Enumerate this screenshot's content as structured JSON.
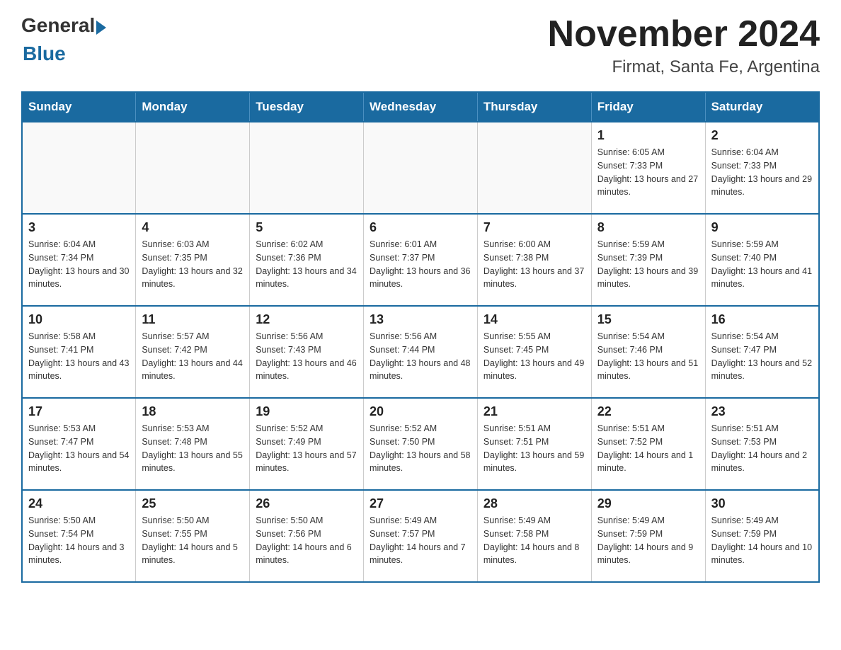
{
  "header": {
    "logo_general": "General",
    "logo_blue": "Blue",
    "title": "November 2024",
    "subtitle": "Firmat, Santa Fe, Argentina"
  },
  "days_of_week": [
    "Sunday",
    "Monday",
    "Tuesday",
    "Wednesday",
    "Thursday",
    "Friday",
    "Saturday"
  ],
  "weeks": [
    [
      {
        "day": "",
        "info": ""
      },
      {
        "day": "",
        "info": ""
      },
      {
        "day": "",
        "info": ""
      },
      {
        "day": "",
        "info": ""
      },
      {
        "day": "",
        "info": ""
      },
      {
        "day": "1",
        "info": "Sunrise: 6:05 AM\nSunset: 7:33 PM\nDaylight: 13 hours and 27 minutes."
      },
      {
        "day": "2",
        "info": "Sunrise: 6:04 AM\nSunset: 7:33 PM\nDaylight: 13 hours and 29 minutes."
      }
    ],
    [
      {
        "day": "3",
        "info": "Sunrise: 6:04 AM\nSunset: 7:34 PM\nDaylight: 13 hours and 30 minutes."
      },
      {
        "day": "4",
        "info": "Sunrise: 6:03 AM\nSunset: 7:35 PM\nDaylight: 13 hours and 32 minutes."
      },
      {
        "day": "5",
        "info": "Sunrise: 6:02 AM\nSunset: 7:36 PM\nDaylight: 13 hours and 34 minutes."
      },
      {
        "day": "6",
        "info": "Sunrise: 6:01 AM\nSunset: 7:37 PM\nDaylight: 13 hours and 36 minutes."
      },
      {
        "day": "7",
        "info": "Sunrise: 6:00 AM\nSunset: 7:38 PM\nDaylight: 13 hours and 37 minutes."
      },
      {
        "day": "8",
        "info": "Sunrise: 5:59 AM\nSunset: 7:39 PM\nDaylight: 13 hours and 39 minutes."
      },
      {
        "day": "9",
        "info": "Sunrise: 5:59 AM\nSunset: 7:40 PM\nDaylight: 13 hours and 41 minutes."
      }
    ],
    [
      {
        "day": "10",
        "info": "Sunrise: 5:58 AM\nSunset: 7:41 PM\nDaylight: 13 hours and 43 minutes."
      },
      {
        "day": "11",
        "info": "Sunrise: 5:57 AM\nSunset: 7:42 PM\nDaylight: 13 hours and 44 minutes."
      },
      {
        "day": "12",
        "info": "Sunrise: 5:56 AM\nSunset: 7:43 PM\nDaylight: 13 hours and 46 minutes."
      },
      {
        "day": "13",
        "info": "Sunrise: 5:56 AM\nSunset: 7:44 PM\nDaylight: 13 hours and 48 minutes."
      },
      {
        "day": "14",
        "info": "Sunrise: 5:55 AM\nSunset: 7:45 PM\nDaylight: 13 hours and 49 minutes."
      },
      {
        "day": "15",
        "info": "Sunrise: 5:54 AM\nSunset: 7:46 PM\nDaylight: 13 hours and 51 minutes."
      },
      {
        "day": "16",
        "info": "Sunrise: 5:54 AM\nSunset: 7:47 PM\nDaylight: 13 hours and 52 minutes."
      }
    ],
    [
      {
        "day": "17",
        "info": "Sunrise: 5:53 AM\nSunset: 7:47 PM\nDaylight: 13 hours and 54 minutes."
      },
      {
        "day": "18",
        "info": "Sunrise: 5:53 AM\nSunset: 7:48 PM\nDaylight: 13 hours and 55 minutes."
      },
      {
        "day": "19",
        "info": "Sunrise: 5:52 AM\nSunset: 7:49 PM\nDaylight: 13 hours and 57 minutes."
      },
      {
        "day": "20",
        "info": "Sunrise: 5:52 AM\nSunset: 7:50 PM\nDaylight: 13 hours and 58 minutes."
      },
      {
        "day": "21",
        "info": "Sunrise: 5:51 AM\nSunset: 7:51 PM\nDaylight: 13 hours and 59 minutes."
      },
      {
        "day": "22",
        "info": "Sunrise: 5:51 AM\nSunset: 7:52 PM\nDaylight: 14 hours and 1 minute."
      },
      {
        "day": "23",
        "info": "Sunrise: 5:51 AM\nSunset: 7:53 PM\nDaylight: 14 hours and 2 minutes."
      }
    ],
    [
      {
        "day": "24",
        "info": "Sunrise: 5:50 AM\nSunset: 7:54 PM\nDaylight: 14 hours and 3 minutes."
      },
      {
        "day": "25",
        "info": "Sunrise: 5:50 AM\nSunset: 7:55 PM\nDaylight: 14 hours and 5 minutes."
      },
      {
        "day": "26",
        "info": "Sunrise: 5:50 AM\nSunset: 7:56 PM\nDaylight: 14 hours and 6 minutes."
      },
      {
        "day": "27",
        "info": "Sunrise: 5:49 AM\nSunset: 7:57 PM\nDaylight: 14 hours and 7 minutes."
      },
      {
        "day": "28",
        "info": "Sunrise: 5:49 AM\nSunset: 7:58 PM\nDaylight: 14 hours and 8 minutes."
      },
      {
        "day": "29",
        "info": "Sunrise: 5:49 AM\nSunset: 7:59 PM\nDaylight: 14 hours and 9 minutes."
      },
      {
        "day": "30",
        "info": "Sunrise: 5:49 AM\nSunset: 7:59 PM\nDaylight: 14 hours and 10 minutes."
      }
    ]
  ]
}
